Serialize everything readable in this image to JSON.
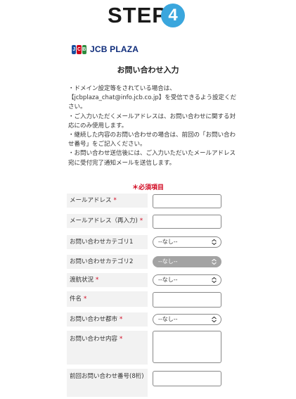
{
  "header": {
    "step_label": "STEP",
    "step_number": "4"
  },
  "logo": {
    "mark_letters": [
      "J",
      "C",
      "B"
    ],
    "mark_colors": [
      "#1a4fa0",
      "#d0021b",
      "#2e8b3e"
    ],
    "text": "JCB PLAZA"
  },
  "form": {
    "title": "お問い合わせ入力",
    "notes": [
      "・ドメイン設定等をされている場合は、\n【jcbplaza_chat@info.jcb.co.jp】を受信できるよう設定ください。",
      "・ご入力いただくメールアドレスは、お問い合わせに関する対応にのみ使用します。",
      "・継続した内容のお問い合わせの場合は、前回の「お問い合わせ番号」をご記入ください。",
      "・お問い合わせ送信後には、ご入力いただいたメールアドレス宛に受付完了通知メールを送信します。"
    ],
    "required_legend": "＊必須項目",
    "fields": {
      "email": {
        "label": "メールアドレス",
        "required_mark": "*"
      },
      "email_confirm": {
        "label": "メールアドレス（再入力)",
        "required_mark": "*"
      },
      "category1": {
        "label": "お問い合わせカテゴリ1",
        "value": "--なし--"
      },
      "category2": {
        "label": "お問い合わせカテゴリ2",
        "value": "--なし--"
      },
      "travel_status": {
        "label": "渡航状況",
        "required_mark": "*",
        "value": "--なし--"
      },
      "subject": {
        "label": "件名",
        "required_mark": "*"
      },
      "city": {
        "label": "お問い合わせ都市",
        "required_mark": "*",
        "value": "--なし--"
      },
      "content": {
        "label": "お問い合わせ内容",
        "required_mark": "*"
      },
      "prev_number": {
        "label": "前回お問い合わせ番号(8桁)"
      }
    }
  },
  "colors": {
    "accent": "#3aa6dd",
    "required": "#d0021b",
    "label_bg": "#f2f2f2",
    "disabled_select": "#a3a3a3"
  }
}
